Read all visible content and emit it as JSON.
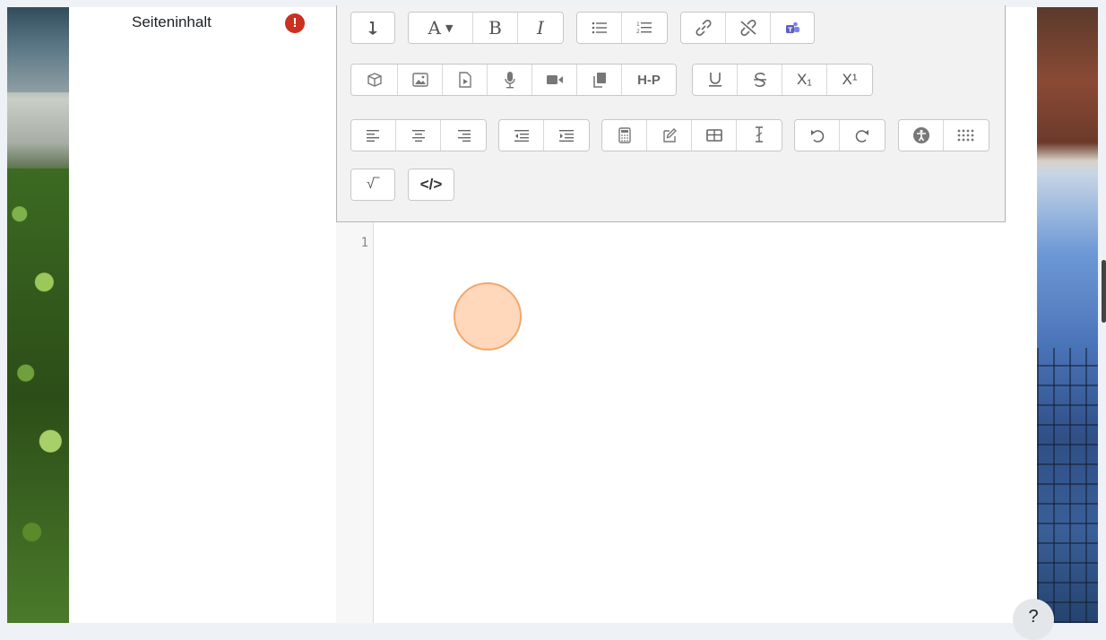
{
  "field": {
    "label": "Seiteninhalt",
    "required_icon": "exclamation-icon",
    "required_mark": "!"
  },
  "toolbar": {
    "rows": [
      [
        [
          "collapse-toolbar-icon"
        ],
        [
          "paragraph-styles-icon",
          "bold-icon",
          "italic-icon"
        ],
        [
          "unordered-list-icon",
          "ordered-list-icon"
        ],
        [
          "link-icon",
          "unlink-icon",
          "teams-meeting-icon"
        ]
      ],
      [
        [
          "content-bank-icon",
          "insert-image-icon",
          "media-file-icon",
          "record-audio-icon",
          "record-video-icon",
          "manage-files-icon",
          "h5p-icon"
        ],
        [
          "underline-icon",
          "strikethrough-icon",
          "subscript-icon",
          "superscript-icon"
        ]
      ],
      [
        [
          "align-left-icon",
          "align-center-icon",
          "align-right-icon"
        ],
        [
          "outdent-icon",
          "indent-icon"
        ],
        [
          "equation-editor-icon",
          "wiris-editor-icon",
          "table-icon",
          "clear-formatting-icon"
        ],
        [
          "undo-icon",
          "redo-icon"
        ],
        [
          "accessibility-checker-icon",
          "screenreader-helper-icon"
        ]
      ],
      [
        [
          "math-editor-icon"
        ],
        [
          "html-source-icon"
        ]
      ]
    ],
    "labels": {
      "paragraph_styles": "A",
      "bold": "B",
      "italic": "I",
      "h5p": "H-P",
      "html_source": "</>",
      "subscript": "X₁",
      "superscript": "X¹",
      "math": "√‾"
    }
  },
  "editor": {
    "line_number": "1",
    "content": ""
  },
  "help": {
    "label": "?"
  },
  "colors": {
    "error": "#ca3120",
    "toolbar_bg": "#f2f2f2",
    "click_marker": "#f2a76b",
    "teams": "#5b5fc7"
  }
}
